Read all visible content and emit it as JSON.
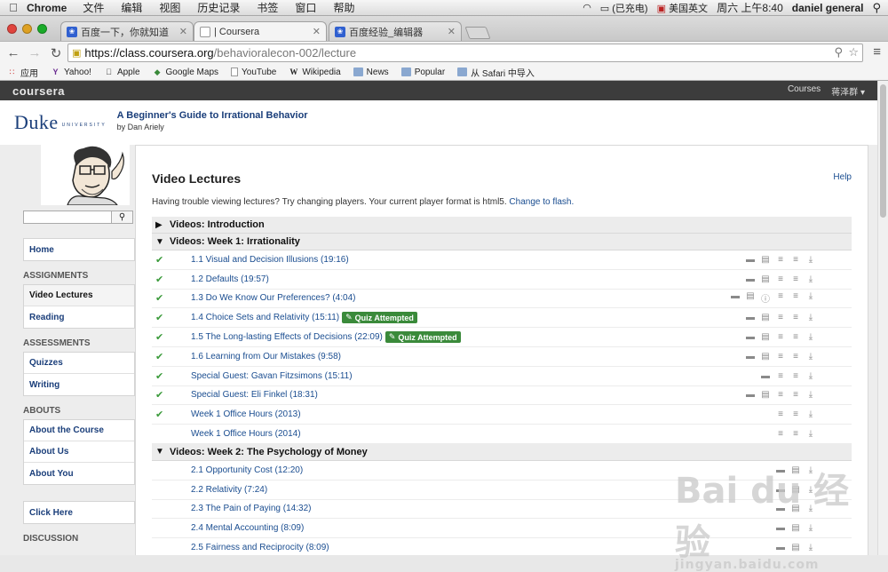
{
  "menubar": {
    "app": "Chrome",
    "items": [
      "文件",
      "编辑",
      "视图",
      "历史记录",
      "书签",
      "窗口",
      "帮助"
    ],
    "battery": "(已充电)",
    "input": "美国英文",
    "clock": "周六 上午8:40",
    "user": "daniel general"
  },
  "tabs": [
    {
      "label": "百度一下，你就知道",
      "icon": "baidu-paw-icon"
    },
    {
      "label": "| Coursera",
      "icon": "document-icon"
    },
    {
      "label": "百度经验_编辑器",
      "icon": "baidu-paw-icon"
    }
  ],
  "url": {
    "host": "https://class.coursera.org",
    "path": "/behavioralecon-002/lecture"
  },
  "bookmarks": [
    "应用",
    "Yahoo!",
    "Apple",
    "Google Maps",
    "YouTube",
    "Wikipedia",
    "News",
    "Popular",
    "从 Safari 中导入"
  ],
  "site": {
    "logo": "coursera",
    "nav_courses": "Courses",
    "nav_user": "蒋泽群 ▾"
  },
  "course": {
    "univ": "Duke",
    "univ_sub": "UNIVERSITY",
    "title": "A Beginner's Guide to Irrational Behavior",
    "instructor": "by Dan Ariely"
  },
  "sidebar": {
    "home": "Home",
    "assignments_head": "ASSIGNMENTS",
    "video_lectures": "Video Lectures",
    "reading": "Reading",
    "assessments_head": "ASSESSMENTS",
    "quizzes": "Quizzes",
    "writing": "Writing",
    "abouts_head": "ABOUTS",
    "about_course": "About the Course",
    "about_us": "About Us",
    "about_you": "About You",
    "click_here": "Click Here",
    "discussion_head": "DISCUSSION"
  },
  "main": {
    "heading": "Video Lectures",
    "help": "Help",
    "trouble": "Having trouble viewing lectures? Try changing players. Your current player format is html5.",
    "change_flash": "Change to flash.",
    "quiz_attempted": "Quiz Attempted"
  },
  "sections": [
    {
      "title": "Videos: Introduction",
      "collapsed": true,
      "items": []
    },
    {
      "title": "Videos: Week 1: Irrationality",
      "collapsed": false,
      "items": [
        {
          "title": "1.1 Visual and Decision Illusions (19:16)",
          "watched": true,
          "quiz": false,
          "icons": [
            "comment",
            "doc",
            "list",
            "list",
            "download"
          ]
        },
        {
          "title": "1.2 Defaults (19:57)",
          "watched": true,
          "quiz": false,
          "icons": [
            "comment",
            "doc",
            "list",
            "list",
            "download"
          ]
        },
        {
          "title": "1.3 Do We Know Our Preferences? (4:04)",
          "watched": true,
          "quiz": false,
          "icons": [
            "comment",
            "doc",
            "info",
            "list",
            "list",
            "download"
          ]
        },
        {
          "title": "1.4 Choice Sets and Relativity (15:11)",
          "watched": true,
          "quiz": true,
          "icons": [
            "comment",
            "doc",
            "list",
            "list",
            "download"
          ]
        },
        {
          "title": "1.5 The Long-lasting Effects of Decisions (22:09)",
          "watched": true,
          "quiz": true,
          "icons": [
            "comment",
            "doc",
            "list",
            "list",
            "download"
          ]
        },
        {
          "title": "1.6 Learning from Our Mistakes (9:58)",
          "watched": true,
          "quiz": false,
          "icons": [
            "comment",
            "doc",
            "list",
            "list",
            "download"
          ]
        },
        {
          "title": "Special Guest: Gavan Fitzsimons (15:11)",
          "watched": true,
          "quiz": false,
          "icons": [
            "comment",
            "list",
            "list",
            "download"
          ]
        },
        {
          "title": "Special Guest: Eli Finkel (18:31)",
          "watched": true,
          "quiz": false,
          "icons": [
            "comment",
            "doc",
            "list",
            "list",
            "download"
          ]
        },
        {
          "title": "Week 1 Office Hours (2013)",
          "watched": true,
          "quiz": false,
          "icons": [
            "list",
            "list",
            "download"
          ]
        },
        {
          "title": "Week 1 Office Hours (2014)",
          "watched": false,
          "quiz": false,
          "icons": [
            "list",
            "list",
            "download"
          ]
        }
      ]
    },
    {
      "title": "Videos: Week 2: The Psychology of Money",
      "collapsed": false,
      "items": [
        {
          "title": "2.1 Opportunity Cost (12:20)",
          "watched": false,
          "quiz": false,
          "icons": [
            "comment",
            "doc",
            "download"
          ]
        },
        {
          "title": "2.2 Relativity (7:24)",
          "watched": false,
          "quiz": false,
          "icons": [
            "comment",
            "doc",
            "download"
          ]
        },
        {
          "title": "2.3 The Pain of Paying (14:32)",
          "watched": false,
          "quiz": false,
          "icons": [
            "comment",
            "doc",
            "download"
          ]
        },
        {
          "title": "2.4 Mental Accounting (8:09)",
          "watched": false,
          "quiz": false,
          "icons": [
            "comment",
            "doc",
            "download"
          ]
        },
        {
          "title": "2.5 Fairness and Reciprocity (8:09)",
          "watched": false,
          "quiz": false,
          "icons": [
            "comment",
            "doc",
            "download"
          ]
        }
      ]
    }
  ],
  "watermark": {
    "main": "Bai du 经验",
    "sub": "jingyan.baidu.com"
  }
}
